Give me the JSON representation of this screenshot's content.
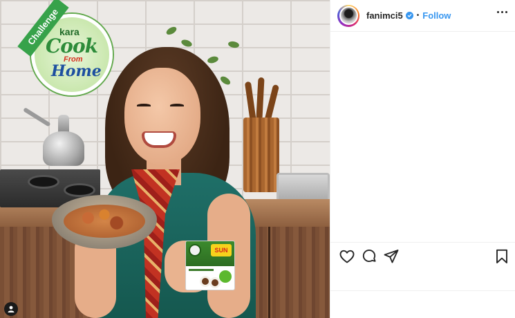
{
  "post": {
    "username": "fanimci5",
    "separator": "•",
    "follow_label": "Follow"
  },
  "image": {
    "badge_ribbon": "Challenge",
    "logo_brand": "kara",
    "logo_line1": "Cook",
    "logo_line2": "From",
    "logo_line3": "Home",
    "product_brand": "SUN"
  },
  "icons": {
    "like": "heart-icon",
    "comment": "comment-icon",
    "share": "paper-plane-icon",
    "save": "bookmark-icon",
    "more": "more-options-icon",
    "verified": "verified-badge-icon",
    "tagged": "user-tag-icon"
  },
  "colors": {
    "accent": "#3897f0",
    "text": "#262626",
    "border": "#efefef"
  }
}
